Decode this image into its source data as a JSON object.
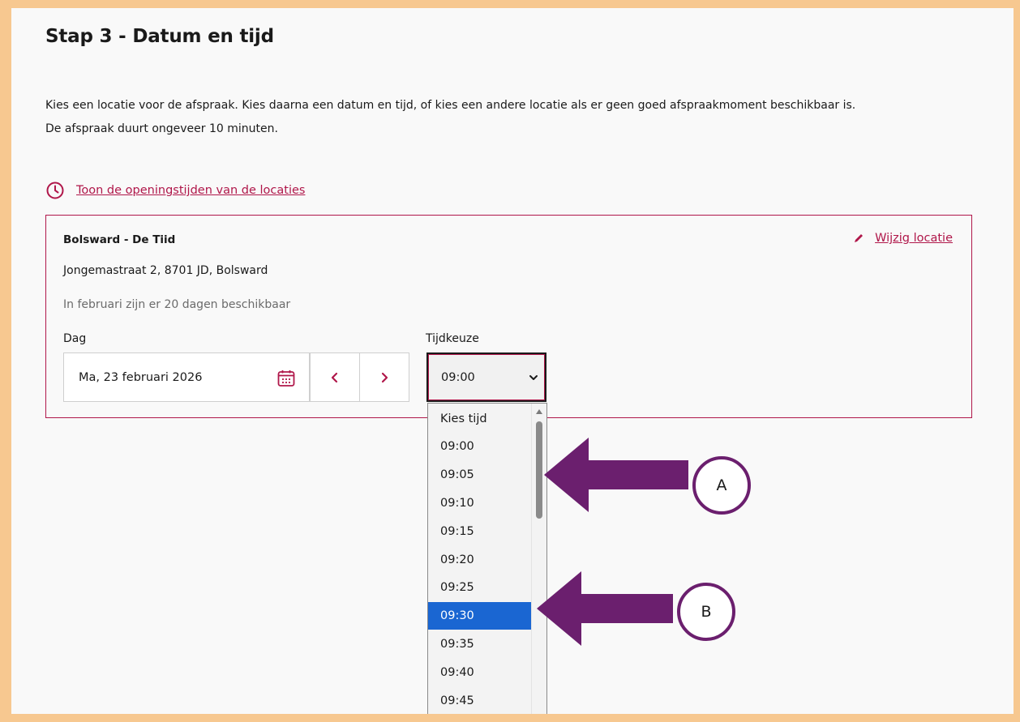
{
  "step_title": "Stap 3 - Datum en tijd",
  "intro": {
    "line1": "Kies een locatie voor de afspraak. Kies daarna een datum en tijd, of kies een andere locatie als er geen goed afspraakmoment beschikbaar is.",
    "line2": "De afspraak duurt ongeveer 10 minuten."
  },
  "hours_link": {
    "label": "Toon de openingstijden van de locaties",
    "icon": "clock-icon"
  },
  "location": {
    "name": "Bolsward - De Tiid",
    "address": "Jongemastraat 2, 8701 JD, Bolsward",
    "availability": "In februari zijn er 20 dagen beschikbaar",
    "edit_label": "Wijzig locatie",
    "edit_icon": "pencil-icon"
  },
  "day": {
    "label": "Dag",
    "value": "Ma, 23 februari 2026",
    "calendar_icon": "calendar-icon",
    "prev_icon": "chevron-left-icon",
    "next_icon": "chevron-right-icon"
  },
  "time": {
    "label": "Tijdkeuze",
    "selected_value": "09:00",
    "options": [
      "Kies tijd",
      "09:00",
      "09:05",
      "09:10",
      "09:15",
      "09:20",
      "09:25",
      "09:30",
      "09:35",
      "09:40",
      "09:45"
    ],
    "highlighted_option": "09:30"
  },
  "annotations": {
    "callout_a": "A",
    "callout_b": "B",
    "arrow_color": "#6b1f6e"
  },
  "colors": {
    "accent": "#b0174a",
    "highlight": "#1a66d2",
    "background_frame": "#f7c890"
  }
}
